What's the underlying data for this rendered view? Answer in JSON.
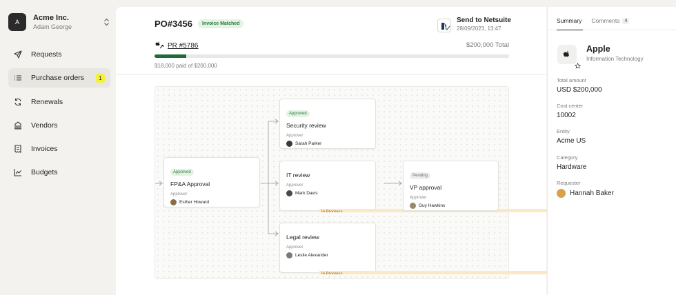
{
  "org": {
    "logo": "A",
    "name": "Acme Inc.",
    "user": "Adam George"
  },
  "nav": [
    {
      "label": "Requests",
      "icon": "send-icon"
    },
    {
      "label": "Purchase orders",
      "icon": "list-icon",
      "badge": "1",
      "active": true
    },
    {
      "label": "Renewals",
      "icon": "refresh-icon"
    },
    {
      "label": "Vendors",
      "icon": "building-icon"
    },
    {
      "label": "Invoices",
      "icon": "receipt-icon"
    },
    {
      "label": "Budgets",
      "icon": "chart-icon"
    }
  ],
  "header": {
    "po_number": "PO#3456",
    "po_status": "Invoice Matched",
    "send_title": "Send to Netsuite",
    "send_date": "28/09/2023, 13:47",
    "pr_link": "PR #5786",
    "total": "$200,000 Total",
    "paid_text": "$18,000 paid of $200,000",
    "progress_fraction": 0.09
  },
  "workflow": {
    "approver_label": "Approver",
    "nodes": {
      "fpa": {
        "status": "Approved",
        "title": "FP&A Approval",
        "person": "Esther Howard"
      },
      "security": {
        "status": "Approved",
        "title": "Security review",
        "person": "Sarah Parker"
      },
      "it": {
        "status": "In Progress",
        "title": "IT review",
        "person": "Mark Davis"
      },
      "legal": {
        "status": "In Progress",
        "title": "Legal review",
        "person": "Leslie Alexander"
      },
      "vp": {
        "status": "Pending",
        "title": "VP approval",
        "person": "Guy Hawkins"
      }
    }
  },
  "summary": {
    "tabs": [
      {
        "label": "Summary"
      },
      {
        "label": "Comments",
        "count": "4"
      }
    ],
    "vendor": {
      "name": "Apple",
      "category": "Information Technology"
    },
    "fields": [
      {
        "label": "Total amount",
        "value": "USD $200,000"
      },
      {
        "label": "Cost center",
        "value": "10002"
      },
      {
        "label": "Entity",
        "value": "Acme US"
      },
      {
        "label": "Category",
        "value": "Hardware"
      }
    ],
    "requester_label": "Requester",
    "requester": "Hannah Baker"
  },
  "colors": {
    "accent": "#1f6b3a",
    "badge_yellow": "#f4f03b",
    "approved_bg": "#e2f3e2",
    "progress_bg": "#fbe8c6"
  }
}
